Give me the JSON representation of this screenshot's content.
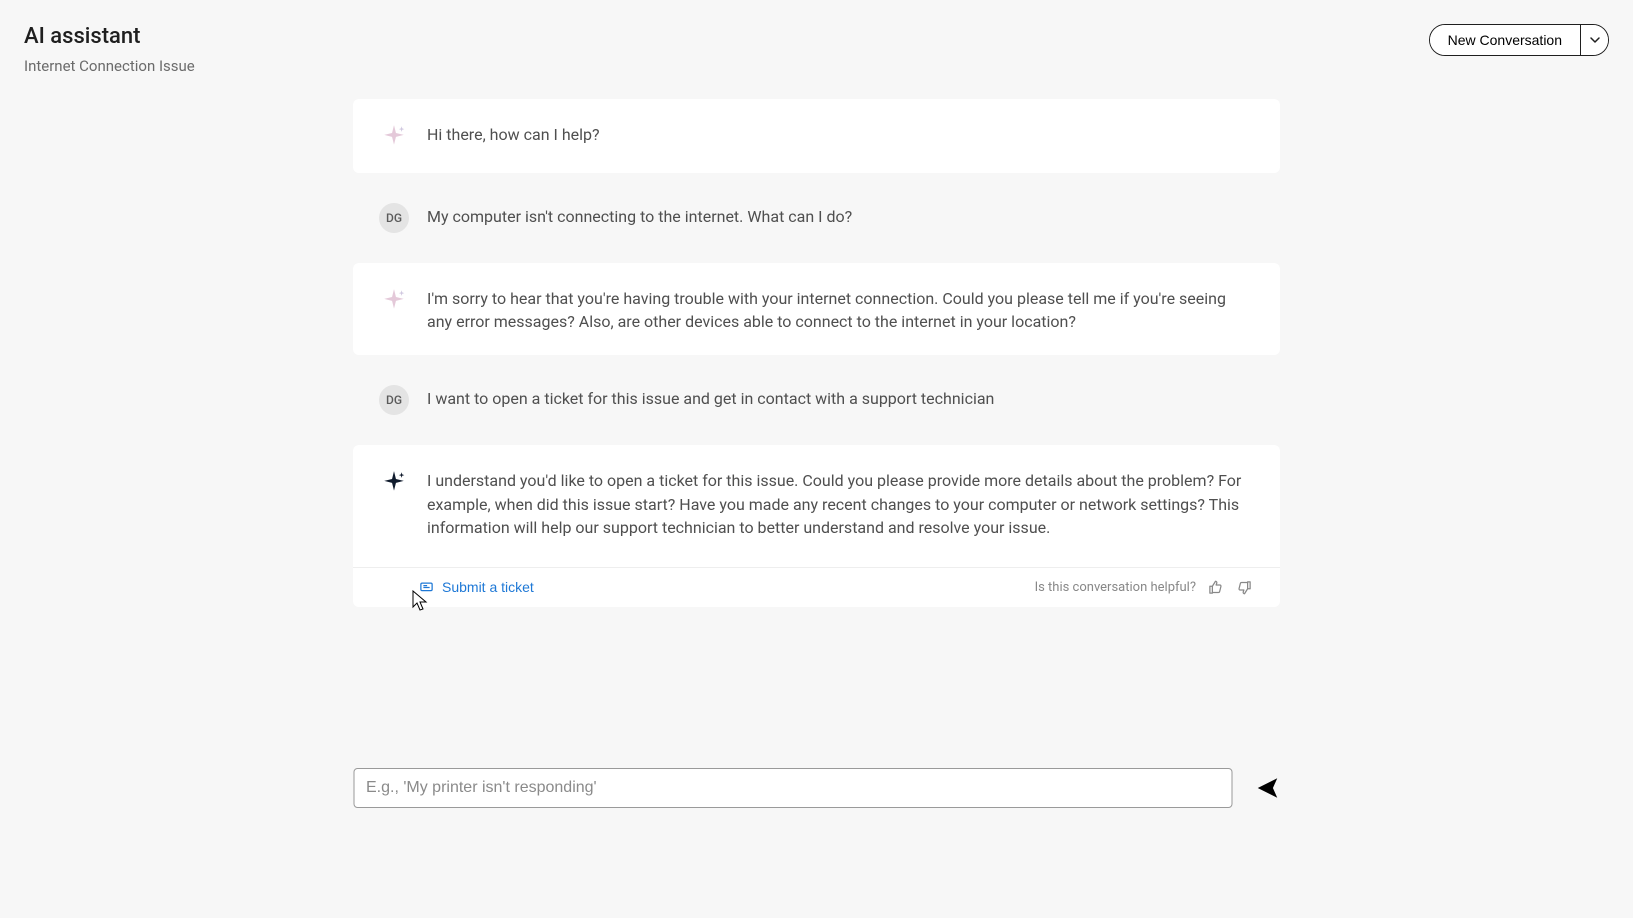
{
  "header": {
    "title": "AI assistant",
    "subtitle": "Internet Connection Issue",
    "new_conversation_label": "New Conversation"
  },
  "user": {
    "initials": "DG"
  },
  "conversation": [
    {
      "role": "assistant",
      "text": "Hi there, how can I help?"
    },
    {
      "role": "user",
      "text": "My computer isn't connecting to the internet. What can I do?"
    },
    {
      "role": "assistant",
      "text": "I'm sorry to hear that you're having trouble with your internet connection. Could you please tell me if you're seeing any error messages? Also, are other devices able to connect to the internet in your location?"
    },
    {
      "role": "user",
      "text": "I want to open a ticket for this issue and get in contact with a support technician"
    },
    {
      "role": "assistant",
      "text": "I understand you'd like to open a ticket for this issue. Could you please provide more details about the problem? For example, when did this issue start? Have you made any recent changes to your computer or network settings? This information will help our support technician to better understand and resolve your issue."
    }
  ],
  "action_bar": {
    "submit_ticket_label": "Submit a ticket",
    "helpful_prompt": "Is this conversation helpful?"
  },
  "composer": {
    "placeholder": "E.g., 'My printer isn't responding'",
    "value": ""
  },
  "colors": {
    "link": "#1e78d6",
    "body_bg": "#f7f7f7",
    "card_bg": "#ffffff",
    "text_secondary": "#6b6b6b"
  }
}
